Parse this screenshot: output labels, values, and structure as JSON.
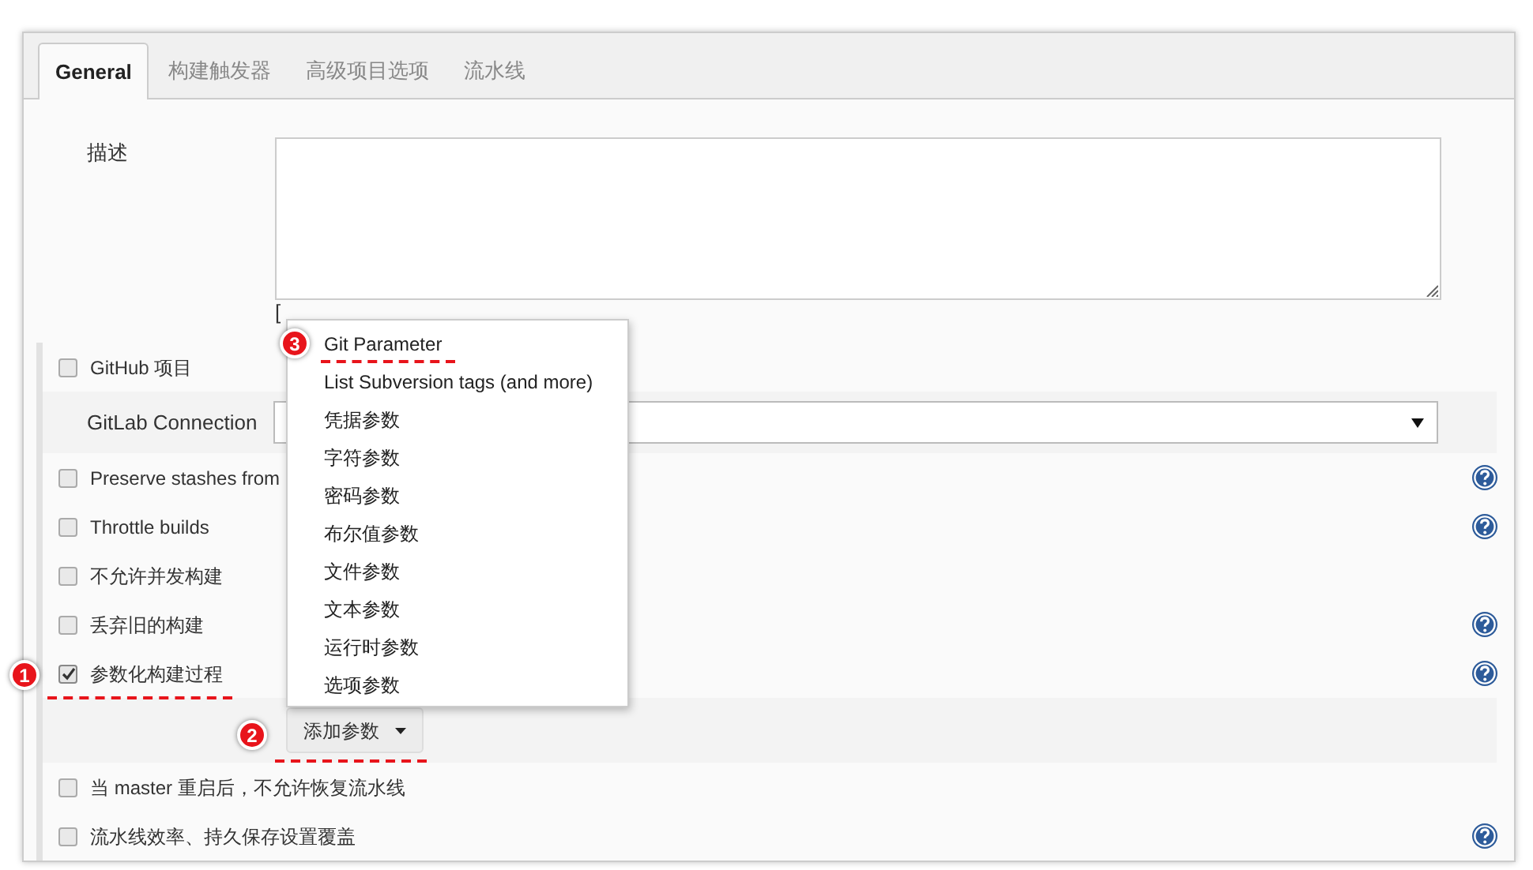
{
  "tabs": [
    {
      "label": "General",
      "selected": true
    },
    {
      "label": "构建触发器",
      "selected": false
    },
    {
      "label": "高级项目选项",
      "selected": false
    },
    {
      "label": "流水线",
      "selected": false
    }
  ],
  "description": {
    "label": "描述",
    "value_links": "["
  },
  "rows": [
    {
      "kind": "checkbox",
      "label": "GitHub 项目",
      "checked": false,
      "help": false
    },
    {
      "kind": "select",
      "label": "GitLab Connection"
    },
    {
      "kind": "checkbox",
      "label": "Preserve stashes from",
      "checked": false,
      "help": true
    },
    {
      "kind": "checkbox",
      "label": "Throttle builds",
      "checked": false,
      "help": true
    },
    {
      "kind": "checkbox",
      "label": "不允许并发构建",
      "checked": false,
      "help": false
    },
    {
      "kind": "checkbox",
      "label": "丢弃旧的构建",
      "checked": false,
      "help": true
    },
    {
      "kind": "checkbox",
      "label": "参数化构建过程",
      "checked": true,
      "help": true
    },
    {
      "kind": "button",
      "label": "添加参数"
    },
    {
      "kind": "checkbox",
      "label": "当 master 重启后，不允许恢复流水线",
      "checked": false,
      "help": false
    },
    {
      "kind": "checkbox",
      "label": "流水线效率、持久保存设置覆盖",
      "checked": false,
      "help": true
    }
  ],
  "menu": {
    "items": [
      "Git Parameter",
      "List Subversion tags (and more)",
      "凭据参数",
      "字符参数",
      "密码参数",
      "布尔值参数",
      "文件参数",
      "文本参数",
      "运行时参数",
      "选项参数"
    ]
  },
  "annotations": [
    "1",
    "2",
    "3"
  ]
}
